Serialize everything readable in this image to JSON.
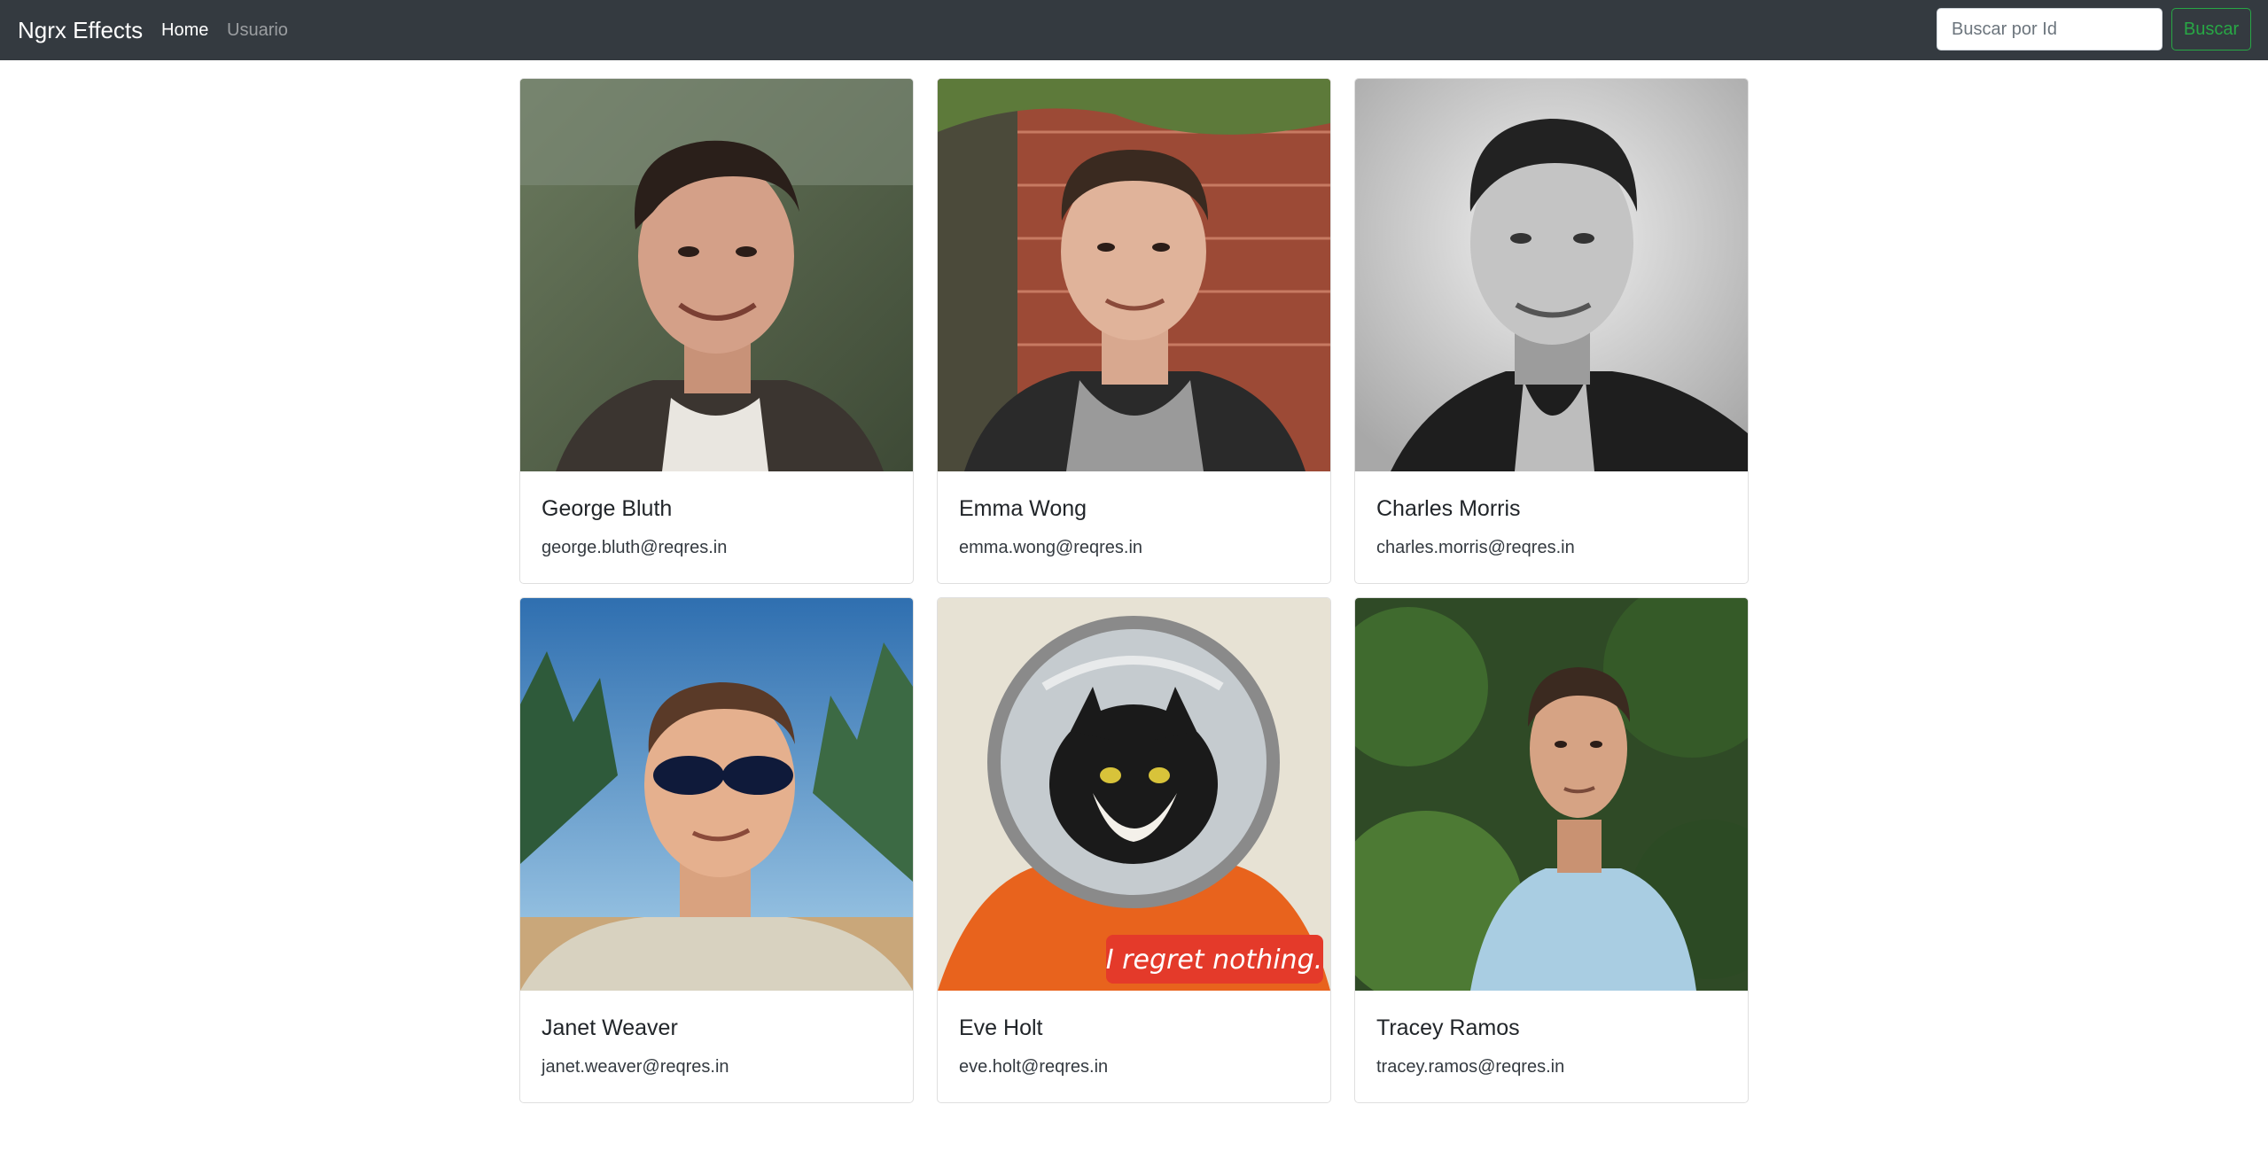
{
  "navbar": {
    "brand": "Ngrx Effects",
    "links": [
      {
        "label": "Home",
        "active": true
      },
      {
        "label": "Usuario",
        "active": false
      }
    ],
    "search_placeholder": "Buscar por Id",
    "search_button": "Buscar"
  },
  "colors": {
    "navbar_bg": "#343a40",
    "button_outline": "#28a745"
  },
  "users": [
    {
      "name": "George Bluth",
      "email": "george.bluth@reqres.in",
      "photo": "avatar-photo"
    },
    {
      "name": "Emma Wong",
      "email": "emma.wong@reqres.in",
      "photo": "avatar-photo"
    },
    {
      "name": "Charles Morris",
      "email": "charles.morris@reqres.in",
      "photo": "avatar-photo"
    },
    {
      "name": "Janet Weaver",
      "email": "janet.weaver@reqres.in",
      "photo": "avatar-photo"
    },
    {
      "name": "Eve Holt",
      "email": "eve.holt@reqres.in",
      "photo": "avatar-photo"
    },
    {
      "name": "Tracey Ramos",
      "email": "tracey.ramos@reqres.in",
      "photo": "avatar-photo"
    }
  ],
  "photo_captions": {
    "eve_holt_banner": "I regret nothing."
  }
}
